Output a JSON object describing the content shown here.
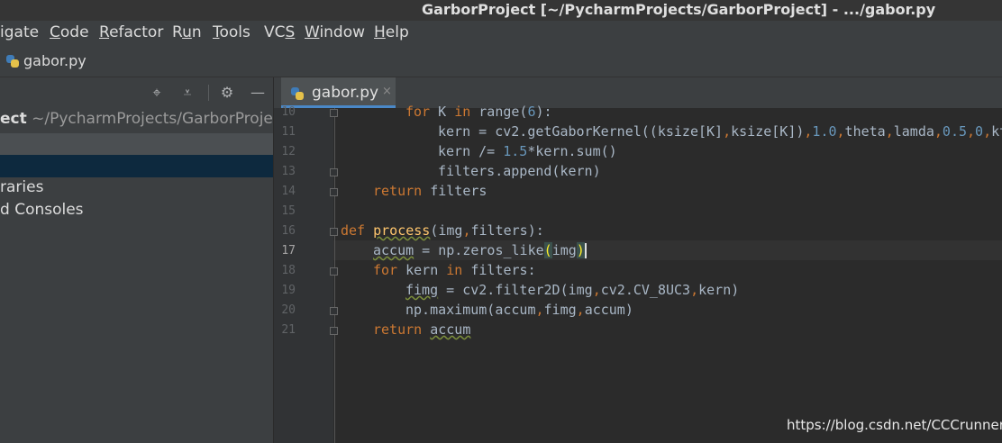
{
  "window": {
    "title": "GarborProject [~/PycharmProjects/GarborProject] - .../gabor.py"
  },
  "menu": {
    "items": [
      {
        "text": "igate",
        "underline_index": -1
      },
      {
        "text": "Code",
        "underline_index": 0
      },
      {
        "text": "Refactor",
        "underline_index": 0
      },
      {
        "text": "Run",
        "underline_index": 1
      },
      {
        "text": "Tools",
        "underline_index": 0
      },
      {
        "text": "VCS",
        "underline_index": 2
      },
      {
        "text": "Window",
        "underline_index": 0
      },
      {
        "text": "Help",
        "underline_index": 0
      }
    ]
  },
  "navbar": {
    "file": "gabor.py"
  },
  "project_panel": {
    "root_label": "ect",
    "root_path": "~/PycharmProjects/GarborProjec",
    "libraries": "raries",
    "consoles": "d Consoles"
  },
  "editor": {
    "tab_label": "gabor.py",
    "tab_close": "×",
    "current_line": "17",
    "lines": [
      {
        "n": "10"
      },
      {
        "n": "11"
      },
      {
        "n": "12"
      },
      {
        "n": "13"
      },
      {
        "n": "14"
      },
      {
        "n": "15"
      },
      {
        "n": "16"
      },
      {
        "n": "17"
      },
      {
        "n": "18"
      },
      {
        "n": "19"
      },
      {
        "n": "20"
      },
      {
        "n": "21"
      }
    ],
    "code": {
      "l10": "for K in range(6):",
      "l11": "kern = cv2.getGaborKernel((ksize[K],ksize[K]),1.0,theta,lamda,0.5,0,kt",
      "l12": "kern /= 1.5*kern.sum()",
      "l13": "filters.append(kern)",
      "l14": "return filters",
      "l16": "def process(img,filters):",
      "l17": "accum = np.zeros_like(img)",
      "l18": "for kern in filters:",
      "l19": "fimg = cv2.filter2D(img,cv2.CV_8UC3,kern)",
      "l20": "np.maximum(accum,fimg,accum)",
      "l21": "return accum"
    }
  },
  "watermark": "https://blog.csdn.net/CCCrunner",
  "colors": {
    "keyword": "#cc7832",
    "number": "#6897bb",
    "function_def": "#ffc66d",
    "default_text": "#a9b7c6",
    "editor_bg": "#2b2b2b",
    "panel_bg": "#3c3f41"
  },
  "icons": {
    "python_file": "python-file-icon",
    "locate": "crosshair-icon",
    "collapse": "collapse-all-icon",
    "settings": "gear-icon",
    "hide": "minimize-icon"
  }
}
